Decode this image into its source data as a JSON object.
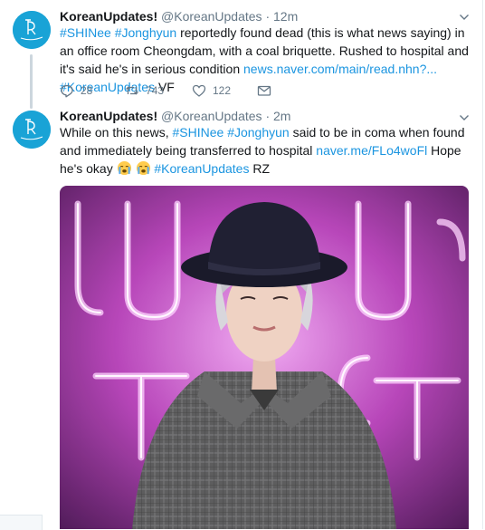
{
  "tweets": [
    {
      "name": "KoreanUpdates!",
      "handle": "@KoreanUpdates",
      "time": "12m",
      "avatar": "profile-avatar",
      "text": [
        {
          "t": "#SHINee #Jonghyun",
          "link": true
        },
        {
          "t": " reportedly found dead (this is what news saying) in an office room Cheongdam, with a coal briquette. Rushed to hospital and it's said he's in serious condition ",
          "link": false
        },
        {
          "t": "news.naver.com/main/read.nhn?...",
          "link": true
        },
        {
          "t": " ",
          "link": false
        },
        {
          "t": "#KoreanUpdates",
          "link": true
        },
        {
          "t": " VF",
          "link": false
        }
      ],
      "actions": {
        "replies": "28",
        "retweets": "743",
        "likes": "122"
      }
    },
    {
      "name": "KoreanUpdates!",
      "handle": "@KoreanUpdates",
      "time": "2m",
      "avatar": "profile-avatar",
      "text": [
        {
          "t": "While on this news, ",
          "link": false
        },
        {
          "t": "#SHINee #Jonghyun",
          "link": true
        },
        {
          "t": " said to be in coma when found and immediately being transferred to hospital ",
          "link": false
        },
        {
          "t": "naver.me/FLo4woFl",
          "link": true
        },
        {
          "t": " Hope he's okay ",
          "link": false
        },
        {
          "t": "[crying-emoji]",
          "emoji": true
        },
        {
          "t": " ",
          "link": false
        },
        {
          "t": "[crying-emoji]",
          "emoji": true
        },
        {
          "t": " ",
          "link": false
        },
        {
          "t": "#KoreanUpdates",
          "link": true
        },
        {
          "t": " RZ",
          "link": false
        }
      ],
      "media": "photo-of-man-in-black-hat-and-plaid-shirt"
    }
  ],
  "colors": {
    "link": "#1b95e0",
    "muted": "#657786",
    "text": "#14171a",
    "avatar_bg": "#19a3d6"
  }
}
